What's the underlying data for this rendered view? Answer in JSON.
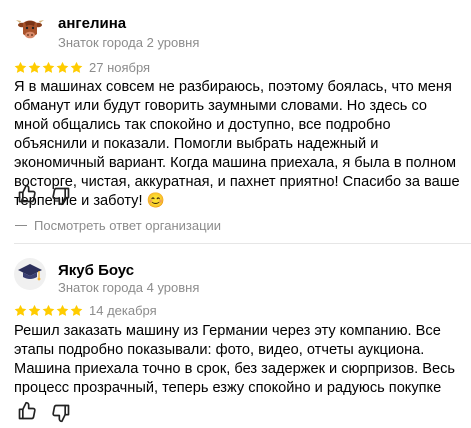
{
  "reviews": [
    {
      "author": "ангелина",
      "badge": "Знаток города 2 уровня",
      "avatar_icon": "cow-avatar-icon",
      "rating": 5,
      "date": "27 ноября",
      "text": "Я в машинах совсем не разбираюсь, поэтому боялась, что меня обманут или будут говорить заумными словами. Но здесь со мной общались так спокойно и доступно, все подробно объяснили и показали. Помогли выбрать надежный и экономичный вариант. Когда машина приехала, я была в полном восторге, чистая, аккуратная, и пахнет приятно! Спасибо за ваше терпение и заботу! 😊",
      "org_reply_label": "Посмотреть ответ организации"
    },
    {
      "author": "Якуб Боус",
      "badge": "Знаток города 4 уровня",
      "avatar_icon": "graduation-cap-icon",
      "rating": 5,
      "date": "14 декабря",
      "text": "Решил заказать машину из Германии через эту компанию. Все этапы подробно показывали: фото, видео, отчеты аукциона. Машина приехала точно в срок, без задержек и сюрпризов. Весь процесс прозрачный, теперь езжу спокойно и радуюсь покупке"
    }
  ],
  "colors": {
    "star": "#fc0",
    "muted_text": "#8c8c8c",
    "divider": "#e6e6e6"
  }
}
